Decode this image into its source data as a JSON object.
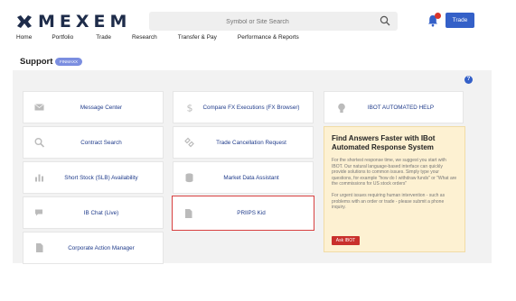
{
  "header": {
    "logo": "MEXEM",
    "search_placeholder": "Symbol or Site Search",
    "trade_label": "Trade"
  },
  "nav": [
    "Home",
    "Portfolio",
    "Trade",
    "Research",
    "Transfer & Pay",
    "Performance & Reports"
  ],
  "page": {
    "title": "Support",
    "pill": "FINMAXX",
    "help_icon": "?"
  },
  "tiles": {
    "message_center": "Message Center",
    "compare_fx": "Compare FX Executions (FX Browser)",
    "contract_search": "Contract Search",
    "trade_cancellation": "Trade Cancellation Request",
    "short_stock": "Short Stock (SLB) Availability",
    "market_data": "Market Data Assistant",
    "ib_chat": "IB Chat (Live)",
    "priips": "PRIIPS Kid",
    "corporate_action": "Corporate Action Manager"
  },
  "ibot": {
    "label": "IBOT AUTOMATED HELP"
  },
  "tips": {
    "heading": "Find Answers Faster with IBot Automated Response System",
    "para1": "For the shortest response time, we suggest you start with IBOT. Our natural language-based interface can quickly provide solutions to common issues. Simply type your questions, for example \"how do I withdraw funds\" or \"What are the commissions for US stock orders\"",
    "para2": "For urgent issues requiring human intervention - such as problems with an order or trade - please submit a phone inquiry.",
    "button": "Ask IBOT"
  }
}
